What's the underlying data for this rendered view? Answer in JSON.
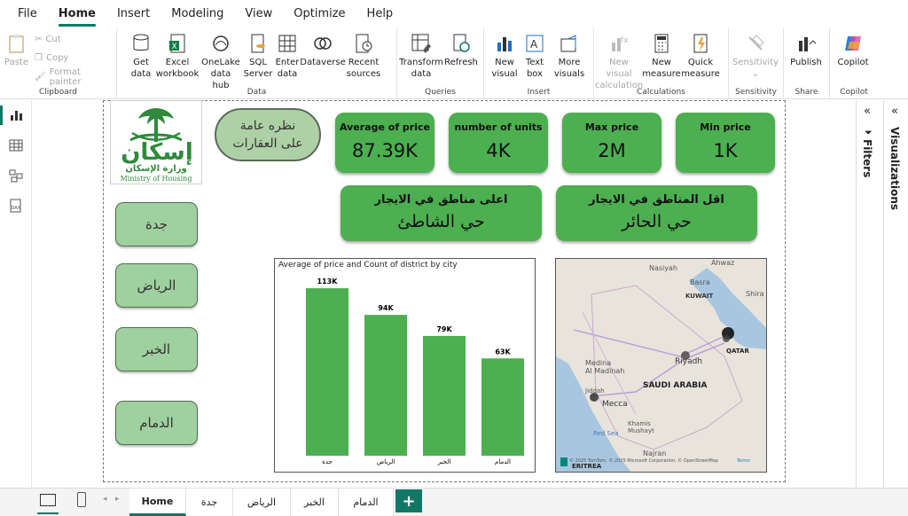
{
  "menu": [
    "File",
    "Home",
    "Insert",
    "Modeling",
    "View",
    "Optimize",
    "Help"
  ],
  "ribbon": {
    "clipboard": {
      "paste": "Paste",
      "cut": "Cut",
      "copy": "Copy",
      "format_painter": "Format painter",
      "label": "Clipboard"
    },
    "data": {
      "get_data_1": "Get",
      "get_data_2": "data",
      "excel_1": "Excel",
      "excel_2": "workbook",
      "onelake_1": "OneLake",
      "onelake_2": "data hub",
      "sql_1": "SQL",
      "sql_2": "Server",
      "enter_1": "Enter",
      "enter_2": "data",
      "dataverse": "Dataverse",
      "recent_1": "Recent",
      "recent_2": "sources",
      "label": "Data"
    },
    "queries": {
      "transform_1": "Transform",
      "transform_2": "data",
      "refresh": "Refresh",
      "label": "Queries"
    },
    "insert": {
      "newvisual_1": "New",
      "newvisual_2": "visual",
      "textbox_1": "Text",
      "textbox_2": "box",
      "morevisuals_1": "More",
      "morevisuals_2": "visuals",
      "label": "Insert"
    },
    "calculations": {
      "newcalc_1": "New visual",
      "newcalc_2": "calculation",
      "newmeasure_1": "New",
      "newmeasure_2": "measure",
      "quickmeasure_1": "Quick",
      "quickmeasure_2": "measure",
      "label": "Calculations"
    },
    "sensitivity": {
      "btn": "Sensitivity",
      "label": "Sensitivity"
    },
    "share": {
      "publish": "Publish",
      "label": "Share"
    },
    "copilot": {
      "btn": "Copilot",
      "label": "Copilot"
    }
  },
  "report": {
    "logo_text_ar": "إسكان",
    "logo_sub_ar": "وزارة الإسكان",
    "logo_sub_en": "Ministry of Housing",
    "overview": "نظره عامة على العقارات",
    "kpis": [
      {
        "title": "Average of price",
        "value": "87.39K"
      },
      {
        "title": "number of units",
        "value": "4K"
      },
      {
        "title": "Max price",
        "value": "2M"
      },
      {
        "title": "Min price",
        "value": "1K"
      }
    ],
    "highest_area": {
      "title": "اعلى مناطق في الايجار",
      "value": "حي الشاطئ"
    },
    "lowest_area": {
      "title": "اقل المناطق في الايجار",
      "value": "حي الحائر"
    },
    "cities": [
      "جدة",
      "الرياض",
      "الخبر",
      "الدمام"
    ]
  },
  "chart_data": {
    "type": "bar",
    "title": "Average of price and Count of district by city",
    "categories": [
      "جدة",
      "الرياض",
      "الخبر",
      "الدمام"
    ],
    "values": [
      113,
      94,
      79,
      63
    ],
    "data_labels": [
      "113K",
      "94K",
      "79K",
      "63K"
    ],
    "bar_color": "#4caf50"
  },
  "map": {
    "labels": {
      "nasiyah": "Nasiyah",
      "ahwaz": "Ahwaz",
      "basra": "Basra",
      "kuwait": "KUWAIT",
      "shira": "Shira",
      "qatar": "QATAR",
      "riyadh": "Riyadh",
      "medina": "Medina",
      "almadinah": "Al Madinah",
      "jiddah": "Jiddah",
      "mecca": "Mecca",
      "saudi": "SAUDI ARABIA",
      "khamis": "Khamis",
      "mushayt": "Mushayt",
      "redsea": "Red Sea",
      "najran": "Najran",
      "eritrea": "ERITREA"
    },
    "attribution": "© 2025 TomTom, © 2025 Microsoft Corporation, © OpenStreetMap",
    "terms": "Terms"
  },
  "panes": {
    "filters": "Filters",
    "visualizations": "Visualizations"
  },
  "pages": [
    "Home",
    "جدة",
    "الرياض",
    "الخبر",
    "الدمام"
  ],
  "colors": {
    "accent": "#117865",
    "kpi_green": "#4caf50",
    "city_btn": "#9fd09f",
    "overview_btn": "#aed0a6"
  }
}
